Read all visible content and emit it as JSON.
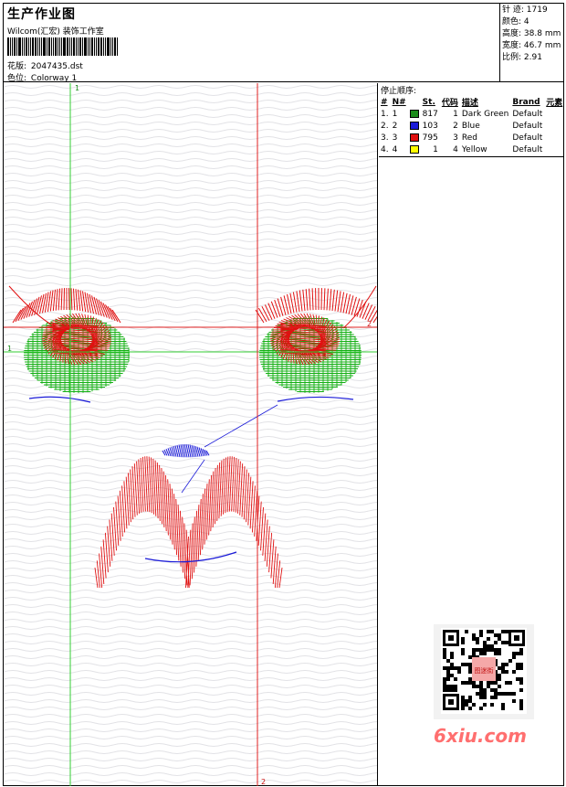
{
  "header": {
    "title": "生产作业图",
    "brand": "Wilcom(汇宏) 装饰工作室",
    "design_label": "花版:",
    "design_value": "2047435.dst",
    "colorway_label": "色位:",
    "colorway_value": "Colorway 1"
  },
  "stats": {
    "stitches_label": "针 迹:",
    "stitches_value": "1719",
    "colors_label": "颜色:",
    "colors_value": "4",
    "height_label": "高度:",
    "height_value": "38.8 mm",
    "width_label": "宽度:",
    "width_value": "46.7 mm",
    "scale_label": "比例:",
    "scale_value": "2.91"
  },
  "stop_sequence": {
    "title": "停止顺序:",
    "headers": [
      "#",
      "N#",
      "St.",
      "代码",
      "描述",
      "Brand",
      "元素"
    ],
    "rows": [
      {
        "index": "1.",
        "needle": "1",
        "stitches": "817",
        "code": "1",
        "description": "Dark Green",
        "brand": "Default",
        "color": "#1b8c1b"
      },
      {
        "index": "2.",
        "needle": "2",
        "stitches": "103",
        "code": "2",
        "description": "Blue",
        "brand": "Default",
        "color": "#1c1cd8"
      },
      {
        "index": "3.",
        "needle": "3",
        "stitches": "795",
        "code": "3",
        "description": "Red",
        "brand": "Default",
        "color": "#e01010"
      },
      {
        "index": "4.",
        "needle": "4",
        "stitches": "1",
        "code": "4",
        "description": "Yellow",
        "brand": "Default",
        "color": "#ffff00"
      }
    ]
  },
  "guides": {
    "green_v_label": "1",
    "green_h_label": "1",
    "red_h_label": "2",
    "red_v_label": "2"
  },
  "watermark": {
    "text": "6xiu.com",
    "seal": "图迷街"
  },
  "colors": {
    "green": "#12b012",
    "blue": "#1c1cd8",
    "red": "#e01010",
    "guide_green": "#33cc33",
    "guide_red": "#e02020"
  }
}
